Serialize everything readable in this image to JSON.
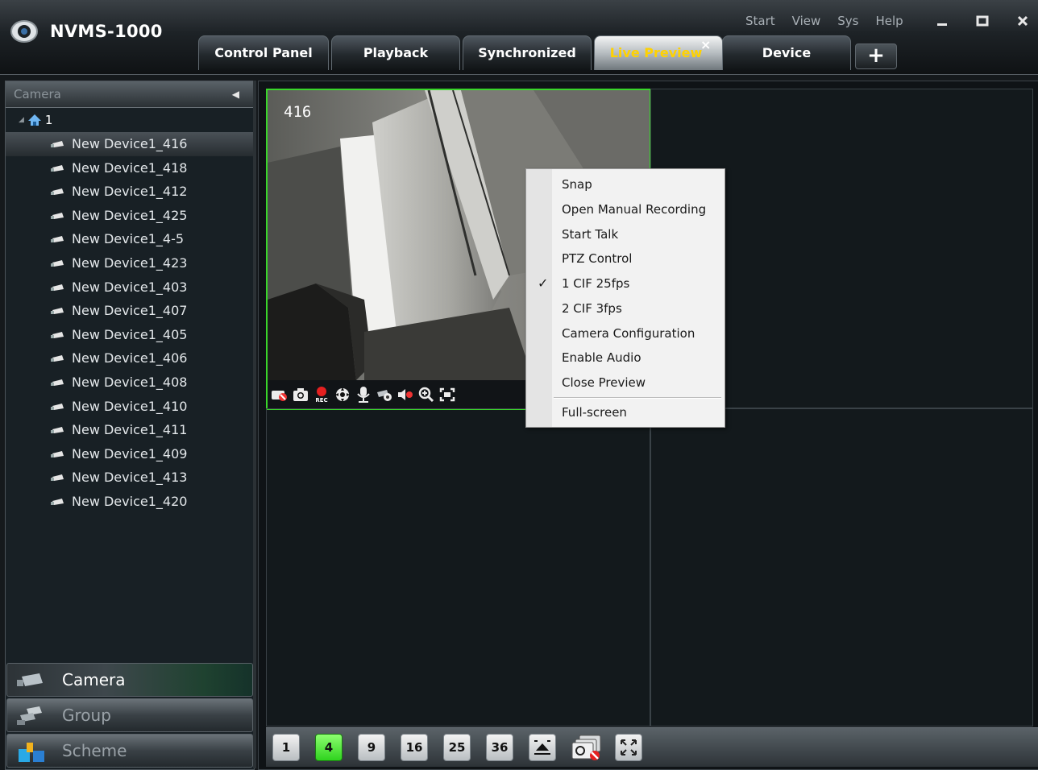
{
  "app": {
    "title": "NVMS-1000"
  },
  "top_menu": [
    "Start",
    "View",
    "Sys",
    "Help"
  ],
  "window_controls": [
    "minimize",
    "maximize",
    "close"
  ],
  "tabs": [
    {
      "label": "Control Panel"
    },
    {
      "label": "Playback"
    },
    {
      "label": "Synchronized"
    },
    {
      "label": "Live Preview",
      "active": true
    },
    {
      "label": "Device"
    }
  ],
  "tab_close_glyph": "×",
  "add_tab_glyph": "+",
  "left_panel": {
    "header": "Camera",
    "root": "1",
    "devices": [
      "New Device1_416",
      "New Device1_418",
      "New Device1_412",
      "New Device1_425",
      "New Device1_4-5",
      "New Device1_423",
      "New Device1_403",
      "New Device1_407",
      "New Device1_405",
      "New Device1_406",
      "New Device1_408",
      "New Device1_410",
      "New Device1_411",
      "New Device1_409",
      "New Device1_413",
      "New Device1_420"
    ],
    "selected_device": "New Device1_416",
    "nav": [
      {
        "label": "Camera",
        "active": true
      },
      {
        "label": "Group"
      },
      {
        "label": "Scheme"
      }
    ]
  },
  "preview": {
    "active_channel_label": "416",
    "layouts": [
      "1",
      "4",
      "9",
      "16",
      "25",
      "36"
    ],
    "active_layout": "4"
  },
  "context_menu": {
    "items": [
      "Snap",
      "Open Manual Recording",
      "Start Talk",
      "PTZ Control",
      "1 CIF 25fps",
      "2 CIF 3fps",
      "Camera Configuration",
      "Enable Audio",
      "Close Preview",
      "Full-screen"
    ],
    "checked": "1 CIF 25fps",
    "check_glyph": "✓"
  },
  "colors": {
    "active_tab_text": "#ffd200",
    "selected_cell_border": "#39d62a",
    "active_layout_button": "#2fd31e"
  },
  "icons": {
    "camera_toolbar": [
      "stop-preview-icon",
      "snapshot-icon",
      "record-icon",
      "ptz-icon",
      "talk-icon",
      "camera-settings-icon",
      "audio-icon",
      "zoom-icon",
      "fullscreen-cell-icon"
    ],
    "bottom_toolbar": [
      "toggle-bar-icon",
      "close-all-preview-icon",
      "fullscreen-icon"
    ]
  }
}
